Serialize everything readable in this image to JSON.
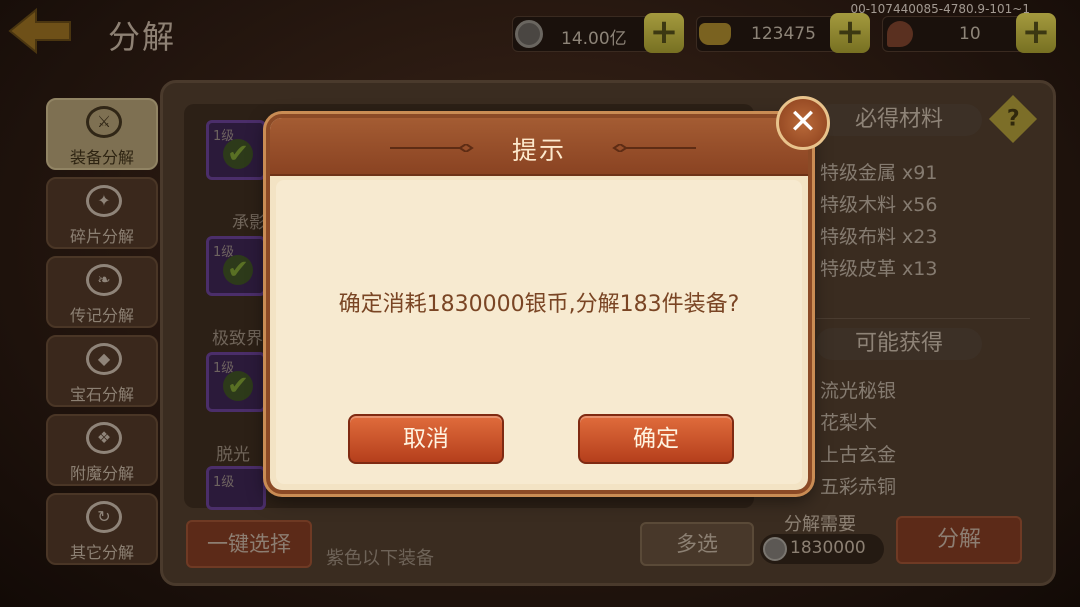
{
  "app": {
    "title": "分解",
    "corner_id": "00-107440085-4780.9-101~1"
  },
  "resources": {
    "silver": {
      "value": "14.00亿",
      "icon": "silver-coin-icon"
    },
    "gold": {
      "value": "123475",
      "icon": "gold-ingot-icon"
    },
    "stamina": {
      "value": "10",
      "icon": "meat-icon"
    }
  },
  "sidebar": {
    "items": [
      {
        "label": "装备分解",
        "icon": "equipment-icon",
        "active": true
      },
      {
        "label": "碎片分解",
        "icon": "fragment-icon",
        "active": false
      },
      {
        "label": "传记分解",
        "icon": "biography-icon",
        "active": false
      },
      {
        "label": "宝石分解",
        "icon": "gem-icon",
        "active": false
      },
      {
        "label": "附魔分解",
        "icon": "enchant-icon",
        "active": false
      },
      {
        "label": "其它分解",
        "icon": "other-icon",
        "active": false
      }
    ]
  },
  "grid": {
    "level_label": "1级",
    "names": [
      "承影",
      "极致界",
      "脱光",
      ""
    ]
  },
  "materials": {
    "guaranteed_title": "必得材料",
    "guaranteed": [
      "特级金属 x91",
      "特级木料 x56",
      "特级布料 x23",
      "特级皮革 x13"
    ],
    "possible_title": "可能获得",
    "possible": [
      "流光秘银",
      "花梨木",
      "上古玄金",
      "五彩赤铜"
    ]
  },
  "bottom": {
    "onekey_label": "一键选择",
    "filter_hint": "紫色以下装备",
    "multi_label": "多选",
    "need_label": "分解需要",
    "cost_value": "1830000",
    "decompose_label": "分解"
  },
  "dialog": {
    "title": "提示",
    "message": "确定消耗1830000银币,分解183件装备?",
    "cancel_label": "取消",
    "confirm_label": "确定"
  },
  "colors": {
    "dialog_bg": "#f7ead0",
    "dialog_header": "#a45c33",
    "button_accent": "#d35a30",
    "message_text": "#7a4524"
  }
}
